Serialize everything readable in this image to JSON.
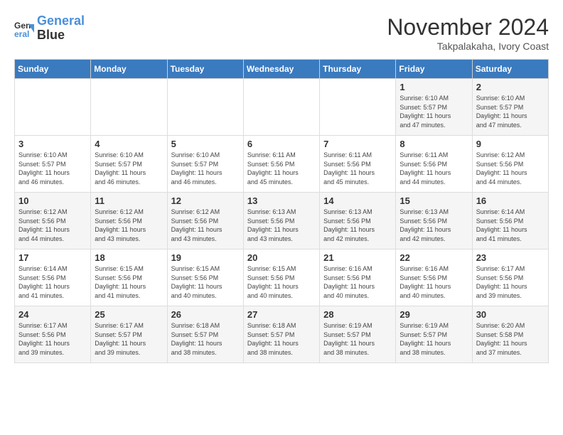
{
  "logo": {
    "line1": "General",
    "line2": "Blue"
  },
  "title": "November 2024",
  "location": "Takpalakaha, Ivory Coast",
  "weekdays": [
    "Sunday",
    "Monday",
    "Tuesday",
    "Wednesday",
    "Thursday",
    "Friday",
    "Saturday"
  ],
  "weeks": [
    [
      {
        "day": "",
        "info": ""
      },
      {
        "day": "",
        "info": ""
      },
      {
        "day": "",
        "info": ""
      },
      {
        "day": "",
        "info": ""
      },
      {
        "day": "",
        "info": ""
      },
      {
        "day": "1",
        "info": "Sunrise: 6:10 AM\nSunset: 5:57 PM\nDaylight: 11 hours\nand 47 minutes."
      },
      {
        "day": "2",
        "info": "Sunrise: 6:10 AM\nSunset: 5:57 PM\nDaylight: 11 hours\nand 47 minutes."
      }
    ],
    [
      {
        "day": "3",
        "info": "Sunrise: 6:10 AM\nSunset: 5:57 PM\nDaylight: 11 hours\nand 46 minutes."
      },
      {
        "day": "4",
        "info": "Sunrise: 6:10 AM\nSunset: 5:57 PM\nDaylight: 11 hours\nand 46 minutes."
      },
      {
        "day": "5",
        "info": "Sunrise: 6:10 AM\nSunset: 5:57 PM\nDaylight: 11 hours\nand 46 minutes."
      },
      {
        "day": "6",
        "info": "Sunrise: 6:11 AM\nSunset: 5:56 PM\nDaylight: 11 hours\nand 45 minutes."
      },
      {
        "day": "7",
        "info": "Sunrise: 6:11 AM\nSunset: 5:56 PM\nDaylight: 11 hours\nand 45 minutes."
      },
      {
        "day": "8",
        "info": "Sunrise: 6:11 AM\nSunset: 5:56 PM\nDaylight: 11 hours\nand 44 minutes."
      },
      {
        "day": "9",
        "info": "Sunrise: 6:12 AM\nSunset: 5:56 PM\nDaylight: 11 hours\nand 44 minutes."
      }
    ],
    [
      {
        "day": "10",
        "info": "Sunrise: 6:12 AM\nSunset: 5:56 PM\nDaylight: 11 hours\nand 44 minutes."
      },
      {
        "day": "11",
        "info": "Sunrise: 6:12 AM\nSunset: 5:56 PM\nDaylight: 11 hours\nand 43 minutes."
      },
      {
        "day": "12",
        "info": "Sunrise: 6:12 AM\nSunset: 5:56 PM\nDaylight: 11 hours\nand 43 minutes."
      },
      {
        "day": "13",
        "info": "Sunrise: 6:13 AM\nSunset: 5:56 PM\nDaylight: 11 hours\nand 43 minutes."
      },
      {
        "day": "14",
        "info": "Sunrise: 6:13 AM\nSunset: 5:56 PM\nDaylight: 11 hours\nand 42 minutes."
      },
      {
        "day": "15",
        "info": "Sunrise: 6:13 AM\nSunset: 5:56 PM\nDaylight: 11 hours\nand 42 minutes."
      },
      {
        "day": "16",
        "info": "Sunrise: 6:14 AM\nSunset: 5:56 PM\nDaylight: 11 hours\nand 41 minutes."
      }
    ],
    [
      {
        "day": "17",
        "info": "Sunrise: 6:14 AM\nSunset: 5:56 PM\nDaylight: 11 hours\nand 41 minutes."
      },
      {
        "day": "18",
        "info": "Sunrise: 6:15 AM\nSunset: 5:56 PM\nDaylight: 11 hours\nand 41 minutes."
      },
      {
        "day": "19",
        "info": "Sunrise: 6:15 AM\nSunset: 5:56 PM\nDaylight: 11 hours\nand 40 minutes."
      },
      {
        "day": "20",
        "info": "Sunrise: 6:15 AM\nSunset: 5:56 PM\nDaylight: 11 hours\nand 40 minutes."
      },
      {
        "day": "21",
        "info": "Sunrise: 6:16 AM\nSunset: 5:56 PM\nDaylight: 11 hours\nand 40 minutes."
      },
      {
        "day": "22",
        "info": "Sunrise: 6:16 AM\nSunset: 5:56 PM\nDaylight: 11 hours\nand 40 minutes."
      },
      {
        "day": "23",
        "info": "Sunrise: 6:17 AM\nSunset: 5:56 PM\nDaylight: 11 hours\nand 39 minutes."
      }
    ],
    [
      {
        "day": "24",
        "info": "Sunrise: 6:17 AM\nSunset: 5:56 PM\nDaylight: 11 hours\nand 39 minutes."
      },
      {
        "day": "25",
        "info": "Sunrise: 6:17 AM\nSunset: 5:57 PM\nDaylight: 11 hours\nand 39 minutes."
      },
      {
        "day": "26",
        "info": "Sunrise: 6:18 AM\nSunset: 5:57 PM\nDaylight: 11 hours\nand 38 minutes."
      },
      {
        "day": "27",
        "info": "Sunrise: 6:18 AM\nSunset: 5:57 PM\nDaylight: 11 hours\nand 38 minutes."
      },
      {
        "day": "28",
        "info": "Sunrise: 6:19 AM\nSunset: 5:57 PM\nDaylight: 11 hours\nand 38 minutes."
      },
      {
        "day": "29",
        "info": "Sunrise: 6:19 AM\nSunset: 5:57 PM\nDaylight: 11 hours\nand 38 minutes."
      },
      {
        "day": "30",
        "info": "Sunrise: 6:20 AM\nSunset: 5:58 PM\nDaylight: 11 hours\nand 37 minutes."
      }
    ]
  ]
}
